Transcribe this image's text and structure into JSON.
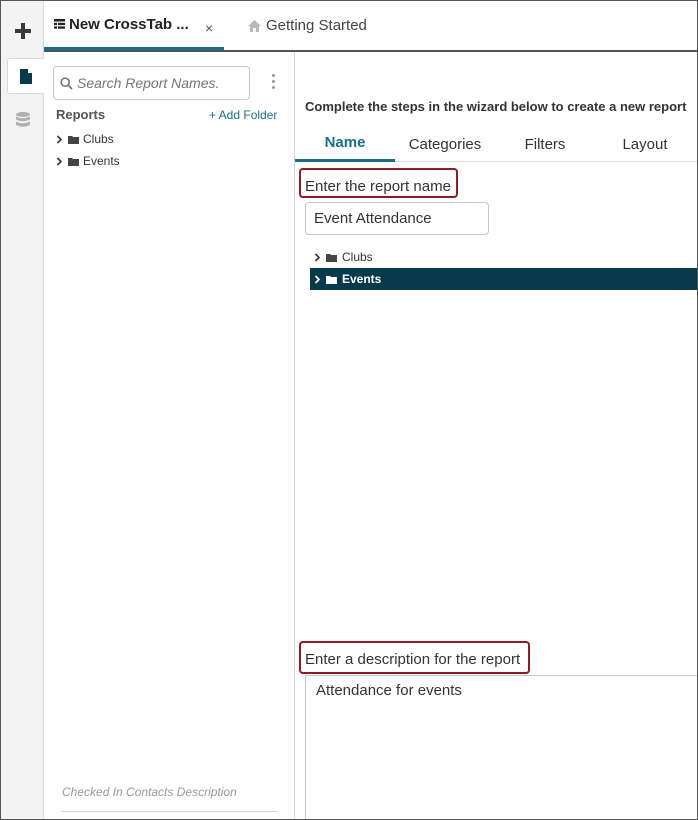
{
  "rail": {
    "items": [
      {
        "icon": "plus-icon"
      },
      {
        "icon": "document-icon"
      },
      {
        "icon": "database-icon"
      }
    ]
  },
  "tabs": [
    {
      "label": "New CrossTab ...",
      "icon": "crosstab-icon",
      "close": "×"
    },
    {
      "label": "Getting Started",
      "icon": "home-icon"
    }
  ],
  "sidebar": {
    "search_placeholder": "Search Report Names.",
    "reports_label": "Reports",
    "add_folder_label": "+ Add Folder",
    "tree": [
      "Clubs",
      "Events"
    ],
    "footer_text": "Checked In Contacts Description"
  },
  "wizard": {
    "intro": "Complete the steps in the wizard below to create a new report",
    "tabs": [
      "Name",
      "Categories",
      "Filters",
      "Layout"
    ],
    "active_tab": "Name",
    "name_label": "Enter the report name",
    "name_value": "Event Attendance",
    "folders": [
      "Clubs",
      "Events"
    ],
    "selected_folder": "Events",
    "description_label": "Enter a description for the report",
    "description_value": "Attendance for events"
  },
  "colors": {
    "accent": "#1a6e8a",
    "selected_row": "#073b4c",
    "highlight_border": "#8b1c2b"
  }
}
